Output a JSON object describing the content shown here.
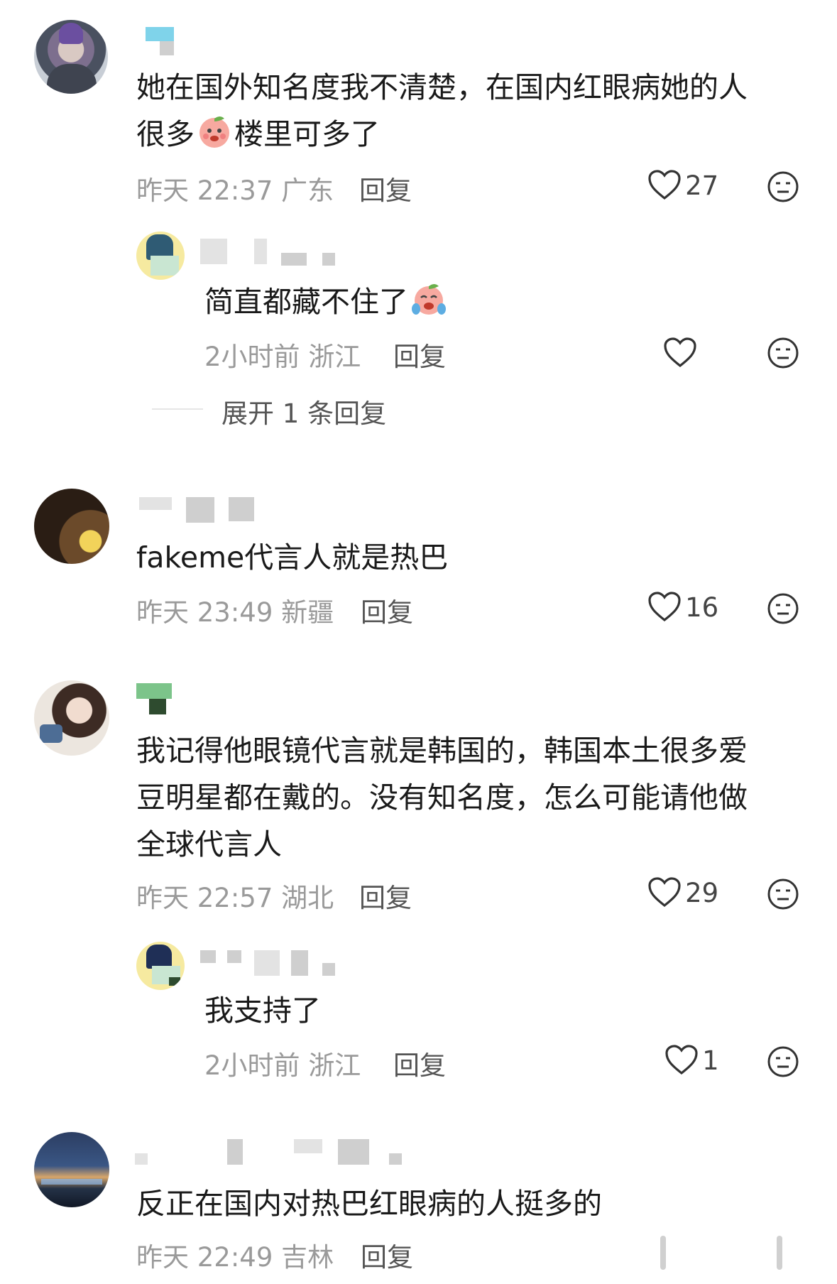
{
  "comments": [
    {
      "text_line1": "她在国外知名度我不清楚，在国内红眼病她的人",
      "text_line2_a": "很多",
      "text_line2_b": "楼里可多了",
      "time": "昨天 22:37",
      "location": "广东",
      "reply_label": "回复",
      "likes": "27",
      "replies": [
        {
          "text": "简直都藏不住了",
          "time": "2小时前",
          "location": "浙江",
          "reply_label": "回复",
          "likes": ""
        }
      ],
      "expand_label": "展开 1 条回复"
    },
    {
      "text_line1": "fakeme代言人就是热巴",
      "time": "昨天 23:49",
      "location": "新疆",
      "reply_label": "回复",
      "likes": "16"
    },
    {
      "text_line1": "我记得他眼镜代言就是韩国的，韩国本土很多爱",
      "text_line2": "豆明星都在戴的。没有知名度，怎么可能请他做",
      "text_line3": "全球代言人",
      "time": "昨天 22:57",
      "location": "湖北",
      "reply_label": "回复",
      "likes": "29",
      "replies": [
        {
          "text": "我支持了",
          "time": "2小时前",
          "location": "浙江",
          "reply_label": "回复",
          "likes": "1"
        }
      ]
    },
    {
      "text_line1": "反正在国内对热巴红眼病的人挺多的",
      "time": "昨天 22:49",
      "location": "吉林",
      "reply_label": "回复"
    }
  ],
  "icons": {
    "like": "heart-outline-icon",
    "dislike": "meh-face-icon",
    "emoji1": "peach-emoji",
    "emoji2": "crying-peach-emoji"
  },
  "colors": {
    "text": "#1a1a1a",
    "meta": "#9a9a9a",
    "icon": "#333333"
  }
}
